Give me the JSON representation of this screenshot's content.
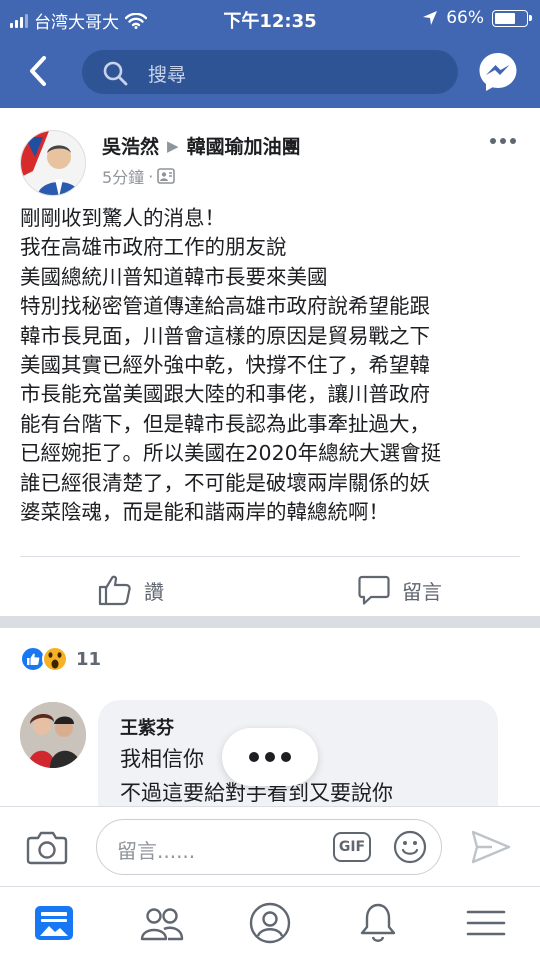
{
  "status_bar": {
    "carrier": "台湾大哥大",
    "time": "下午12:35",
    "battery": "66%",
    "battery_level": 0.66
  },
  "search": {
    "placeholder": "搜尋"
  },
  "post": {
    "author": "吳浩然",
    "group": "韓國瑜加油團",
    "time": "5分鐘",
    "separator": "·",
    "lines": [
      "剛剛收到驚人的消息！",
      "我在高雄市政府工作的朋友說",
      "美國總統川普知道韓市長要來美國",
      "特別找秘密管道傳達給高雄市政府說希望能跟",
      "韓市長見面，川普會這樣的原因是貿易戰之下",
      "美國其實已經外強中乾，快撐不住了，希望韓",
      "市長能充當美國跟大陸的和事佬，讓川普政府",
      "能有台階下，但是韓市長認為此事牽扯過大，",
      "已經婉拒了。所以美國在2020年總統大選會挺",
      "誰已經很清楚了，不可能是破壞兩岸關係的妖",
      "婆菜陰魂，而是能和諧兩岸的韓總統啊！"
    ],
    "like_label": "讚",
    "comment_label": "留言",
    "reaction_count": "11"
  },
  "comment": {
    "name": "王紫芬",
    "line1": "我相信你",
    "line2": "不過這要給對手看到又要說你"
  },
  "composer": {
    "placeholder": "留言......",
    "gif_label": "GIF"
  },
  "colors": {
    "brand": "#4267b2",
    "search_bg": "#2f5496",
    "like_blue": "#1877f2",
    "wow_yellow": "#f7b125"
  }
}
